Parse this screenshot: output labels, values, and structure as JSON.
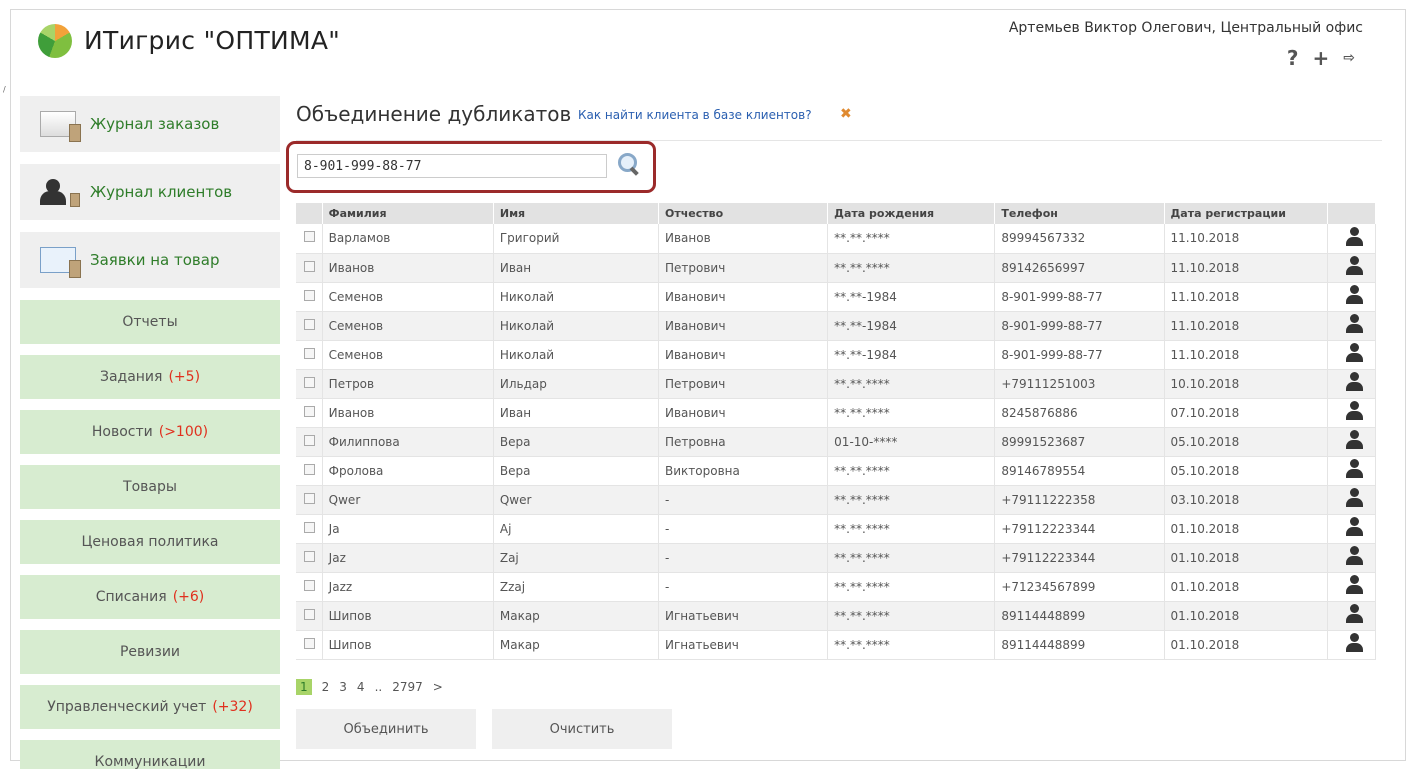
{
  "header": {
    "app_title": "ИТигрис \"ОПТИМА\"",
    "user": "Артемьев Виктор Олегович, Центральный офис",
    "icons": [
      "help-icon",
      "plus-icon",
      "exit-icon"
    ]
  },
  "sidebar": {
    "top_items": [
      {
        "label": "Журнал заказов",
        "icon": "order-journal-icon"
      },
      {
        "label": "Журнал клиентов",
        "icon": "client-journal-icon"
      },
      {
        "label": "Заявки на товар",
        "icon": "product-requests-icon"
      }
    ],
    "items": [
      {
        "label": "Отчеты",
        "count": ""
      },
      {
        "label": "Задания",
        "count": "(+5)"
      },
      {
        "label": "Новости",
        "count": "(>100)"
      },
      {
        "label": "Товары",
        "count": ""
      },
      {
        "label": "Ценовая политика",
        "count": ""
      },
      {
        "label": "Списания",
        "count": "(+6)"
      },
      {
        "label": "Ревизии",
        "count": ""
      },
      {
        "label": "Управленческий учет",
        "count": "(+32)"
      },
      {
        "label": "Коммуникации",
        "count": ""
      }
    ]
  },
  "main": {
    "title": "Объединение дубликатов",
    "help_link": "Как найти клиента в базе клиентов?",
    "search": {
      "value": "8-901-999-88-77"
    },
    "columns": [
      "Фамилия",
      "Имя",
      "Отчество",
      "Дата рождения",
      "Телефон",
      "Дата регистрации"
    ],
    "rows": [
      [
        "Варламов",
        "Григорий",
        "Иванов",
        "**.**.****",
        "89994567332",
        "11.10.2018"
      ],
      [
        "Иванов",
        "Иван",
        "Петрович",
        "**.**.****",
        "89142656997",
        "11.10.2018"
      ],
      [
        "Семенов",
        "Николай",
        "Иванович",
        "**.**-1984",
        "8-901-999-88-77",
        "11.10.2018"
      ],
      [
        "Семенов",
        "Николай",
        "Иванович",
        "**.**-1984",
        "8-901-999-88-77",
        "11.10.2018"
      ],
      [
        "Семенов",
        "Николай",
        "Иванович",
        "**.**-1984",
        "8-901-999-88-77",
        "11.10.2018"
      ],
      [
        "Петров",
        "Ильдар",
        "Петрович",
        "**.**.****",
        "+79111251003",
        "10.10.2018"
      ],
      [
        "Иванов",
        "Иван",
        "Иванович",
        "**.**.****",
        "8245876886",
        "07.10.2018"
      ],
      [
        "Филиппова",
        "Вера",
        "Петровна",
        "01-10-****",
        "89991523687",
        "05.10.2018"
      ],
      [
        "Фролова",
        "Вера",
        "Викторовна",
        "**.**.****",
        "89146789554",
        "05.10.2018"
      ],
      [
        "Qwer",
        "Qwer",
        "-",
        "**.**.****",
        "+79111222358",
        "03.10.2018"
      ],
      [
        "Ja",
        "Aj",
        "-",
        "**.**.****",
        "+79112223344",
        "01.10.2018"
      ],
      [
        "Jaz",
        "Zaj",
        "-",
        "**.**.****",
        "+79112223344",
        "01.10.2018"
      ],
      [
        "Jazz",
        "Zzaj",
        "-",
        "**.**.****",
        "+71234567899",
        "01.10.2018"
      ],
      [
        "Шипов",
        "Макар",
        "Игнатьевич",
        "**.**.****",
        "89114448899",
        "01.10.2018"
      ],
      [
        "Шипов",
        "Макар",
        "Игнатьевич",
        "**.**.****",
        "89114448899",
        "01.10.2018"
      ]
    ],
    "pager": {
      "current": "1",
      "pages": [
        "2",
        "3",
        "4"
      ],
      "ellipsis": "..",
      "last": "2797",
      "next": ">"
    },
    "buttons": {
      "merge": "Объединить",
      "clear": "Очистить"
    }
  },
  "colors": {
    "accent_green": "#2f7d2a",
    "sidebar_bg": "#d7ecd0",
    "count_red": "#e0301e",
    "search_frame": "#9b2a2a"
  }
}
